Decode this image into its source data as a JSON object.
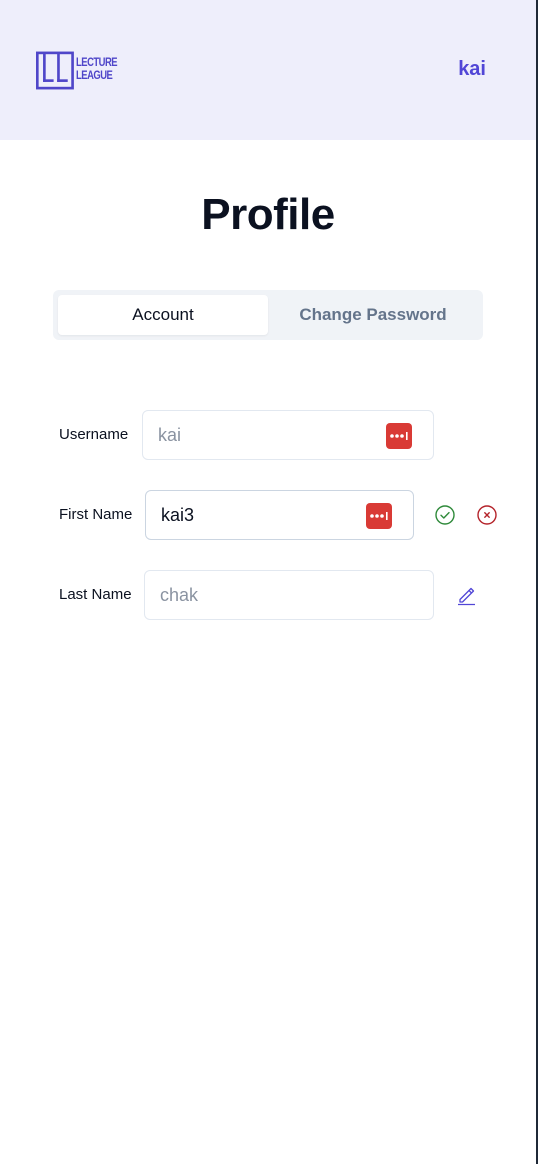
{
  "header": {
    "logo_text_line1": "LECTURE",
    "logo_text_line2": "LEAGUE",
    "user_name": "kai"
  },
  "page": {
    "title": "Profile"
  },
  "tabs": [
    {
      "label": "Account",
      "active": true
    },
    {
      "label": "Change Password",
      "active": false
    }
  ],
  "form": {
    "username": {
      "label": "Username",
      "placeholder": "kai"
    },
    "first_name": {
      "label": "First Name",
      "value": "kai3"
    },
    "last_name": {
      "label": "Last Name",
      "placeholder": "chak"
    }
  },
  "icons": {
    "password_manager": "password-manager-icon",
    "confirm": "check-circle-icon",
    "cancel": "x-circle-icon",
    "edit": "pencil-icon"
  },
  "colors": {
    "brand": "#5146d6",
    "header_bg": "#eeeefb",
    "confirm": "#2f8a3a",
    "cancel": "#b4232a",
    "password_manager": "#d93a35"
  }
}
